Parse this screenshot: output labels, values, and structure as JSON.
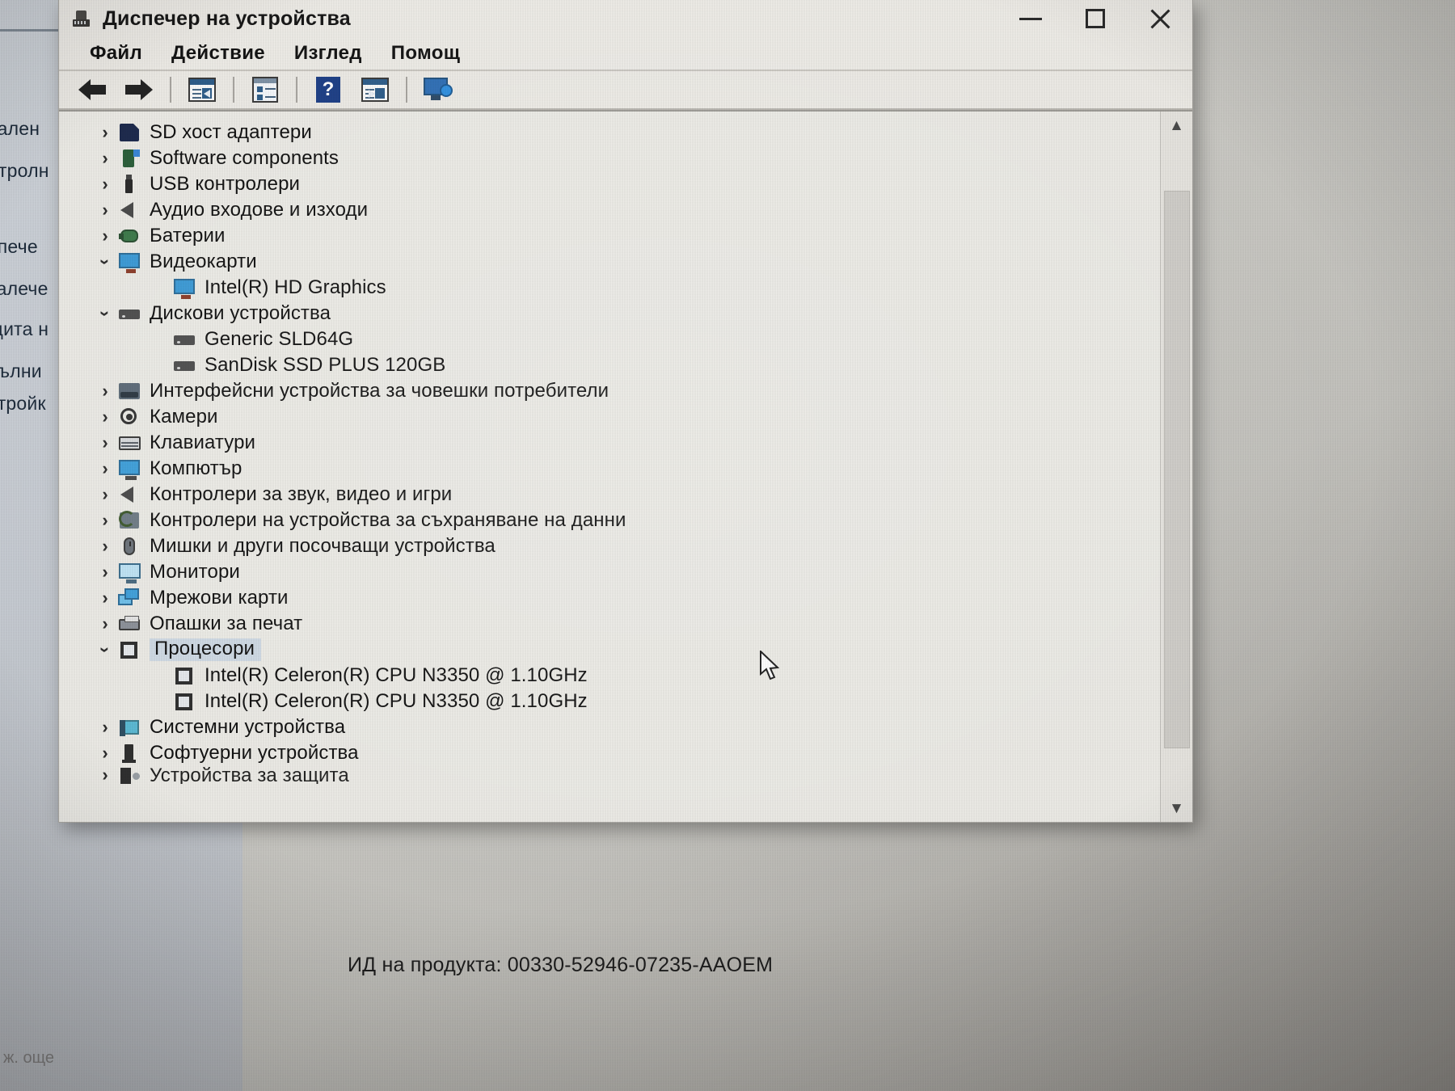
{
  "window": {
    "title": "Диспечер на устройства",
    "title_icon": "device-manager-icon",
    "controls": {
      "minimize": "minimize-icon",
      "maximize": "maximize-icon",
      "close": "close-icon"
    }
  },
  "menubar": {
    "items": [
      "Файл",
      "Действие",
      "Изглед",
      "Помощ"
    ]
  },
  "toolbar": {
    "items": [
      {
        "name": "back-arrow-icon"
      },
      {
        "name": "forward-arrow-icon"
      },
      {
        "name": "properties-icon"
      },
      {
        "name": "update-driver-icon"
      },
      {
        "name": "help-icon"
      },
      {
        "name": "scan-hardware-icon"
      },
      {
        "name": "show-hidden-devices-icon"
      }
    ]
  },
  "tree": {
    "nodes": [
      {
        "label": "SD хост адаптери",
        "icon": "sd-host-adapter-icon",
        "level": 1,
        "state": "collapsed"
      },
      {
        "label": "Software components",
        "icon": "software-components-icon",
        "level": 1,
        "state": "collapsed"
      },
      {
        "label": "USB контролери",
        "icon": "usb-controller-icon",
        "level": 1,
        "state": "collapsed"
      },
      {
        "label": "Аудио входове и изходи",
        "icon": "audio-icon",
        "level": 1,
        "state": "collapsed"
      },
      {
        "label": "Батерии",
        "icon": "battery-icon",
        "level": 1,
        "state": "collapsed"
      },
      {
        "label": "Видеокарти",
        "icon": "display-adapter-icon",
        "level": 1,
        "state": "expanded"
      },
      {
        "label": "Intel(R) HD Graphics",
        "icon": "display-adapter-icon",
        "level": 2,
        "state": "leaf"
      },
      {
        "label": "Дискови устройства",
        "icon": "disk-drive-icon",
        "level": 1,
        "state": "expanded"
      },
      {
        "label": "Generic SLD64G",
        "icon": "disk-drive-icon",
        "level": 2,
        "state": "leaf"
      },
      {
        "label": "SanDisk SSD PLUS 120GB",
        "icon": "disk-drive-icon",
        "level": 2,
        "state": "leaf"
      },
      {
        "label": "Интерфейсни устройства за човешки потребители",
        "icon": "hid-icon",
        "level": 1,
        "state": "collapsed"
      },
      {
        "label": "Камери",
        "icon": "camera-icon",
        "level": 1,
        "state": "collapsed"
      },
      {
        "label": "Клавиатури",
        "icon": "keyboard-icon",
        "level": 1,
        "state": "collapsed"
      },
      {
        "label": "Компютър",
        "icon": "computer-icon",
        "level": 1,
        "state": "collapsed"
      },
      {
        "label": "Контролери за звук, видео и игри",
        "icon": "audio-icon",
        "level": 1,
        "state": "collapsed"
      },
      {
        "label": "Контролери на устройства за съхраняване на данни",
        "icon": "storage-controller-icon",
        "level": 1,
        "state": "collapsed"
      },
      {
        "label": "Мишки и други посочващи устройства",
        "icon": "mouse-icon",
        "level": 1,
        "state": "collapsed"
      },
      {
        "label": "Монитори",
        "icon": "monitor-icon",
        "level": 1,
        "state": "collapsed"
      },
      {
        "label": "Мрежови карти",
        "icon": "network-adapter-icon",
        "level": 1,
        "state": "collapsed"
      },
      {
        "label": "Опашки за печат",
        "icon": "printer-icon",
        "level": 1,
        "state": "collapsed"
      },
      {
        "label": "Процесори",
        "icon": "processor-icon",
        "level": 1,
        "state": "expanded",
        "selected": true
      },
      {
        "label": "Intel(R) Celeron(R) CPU N3350 @ 1.10GHz",
        "icon": "processor-icon",
        "level": 2,
        "state": "leaf"
      },
      {
        "label": "Intel(R) Celeron(R) CPU N3350 @ 1.10GHz",
        "icon": "processor-icon",
        "level": 2,
        "state": "leaf"
      },
      {
        "label": "Системни устройства",
        "icon": "system-device-icon",
        "level": 1,
        "state": "collapsed"
      },
      {
        "label": "Софтуерни устройства",
        "icon": "software-device-icon",
        "level": 1,
        "state": "collapsed"
      },
      {
        "label": "Устройства за защита",
        "icon": "security-device-icon",
        "level": 1,
        "state": "collapsed",
        "clipped": true
      }
    ]
  },
  "scrollbar": {
    "up_arrow": "scroll-up-icon",
    "down_arrow": "scroll-down-icon"
  },
  "desktop": {
    "product_id": "ИД на продукта:  00330-52946-07235-AAOEM",
    "background_panel_items": [
      "ачален",
      "онтролн",
      "испече",
      "тдалече",
      "ащита н",
      "опълни",
      "астройк"
    ],
    "bottom_text": "ж. още"
  },
  "colors": {
    "selection": "#cfd9e4",
    "accent": "#2e5d8a",
    "window_bg": "#eceae5",
    "tree_bg": "#ecebe6"
  }
}
